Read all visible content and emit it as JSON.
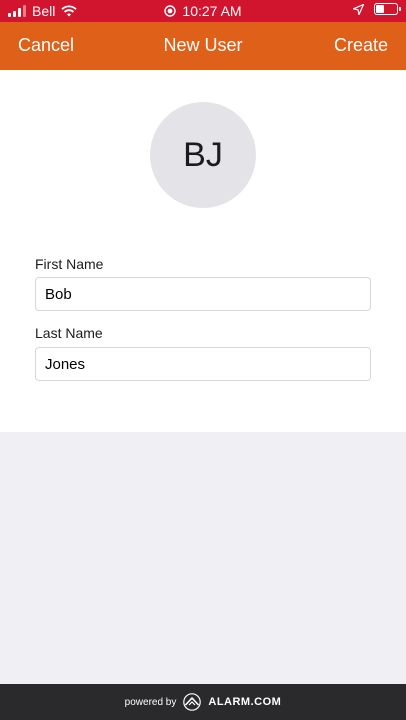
{
  "status_bar": {
    "carrier": "Bell",
    "time": "10:27 AM"
  },
  "nav": {
    "cancel_label": "Cancel",
    "title": "New User",
    "create_label": "Create"
  },
  "avatar": {
    "initials": "BJ"
  },
  "form": {
    "first_name_label": "First Name",
    "first_name_value": "Bob",
    "last_name_label": "Last Name",
    "last_name_value": "Jones"
  },
  "footer": {
    "powered_by": "powered by",
    "brand": "ALARM.COM"
  },
  "colors": {
    "status_bar": "#d2152f",
    "nav_bar": "#de6019",
    "footer": "#2a2a2c"
  }
}
